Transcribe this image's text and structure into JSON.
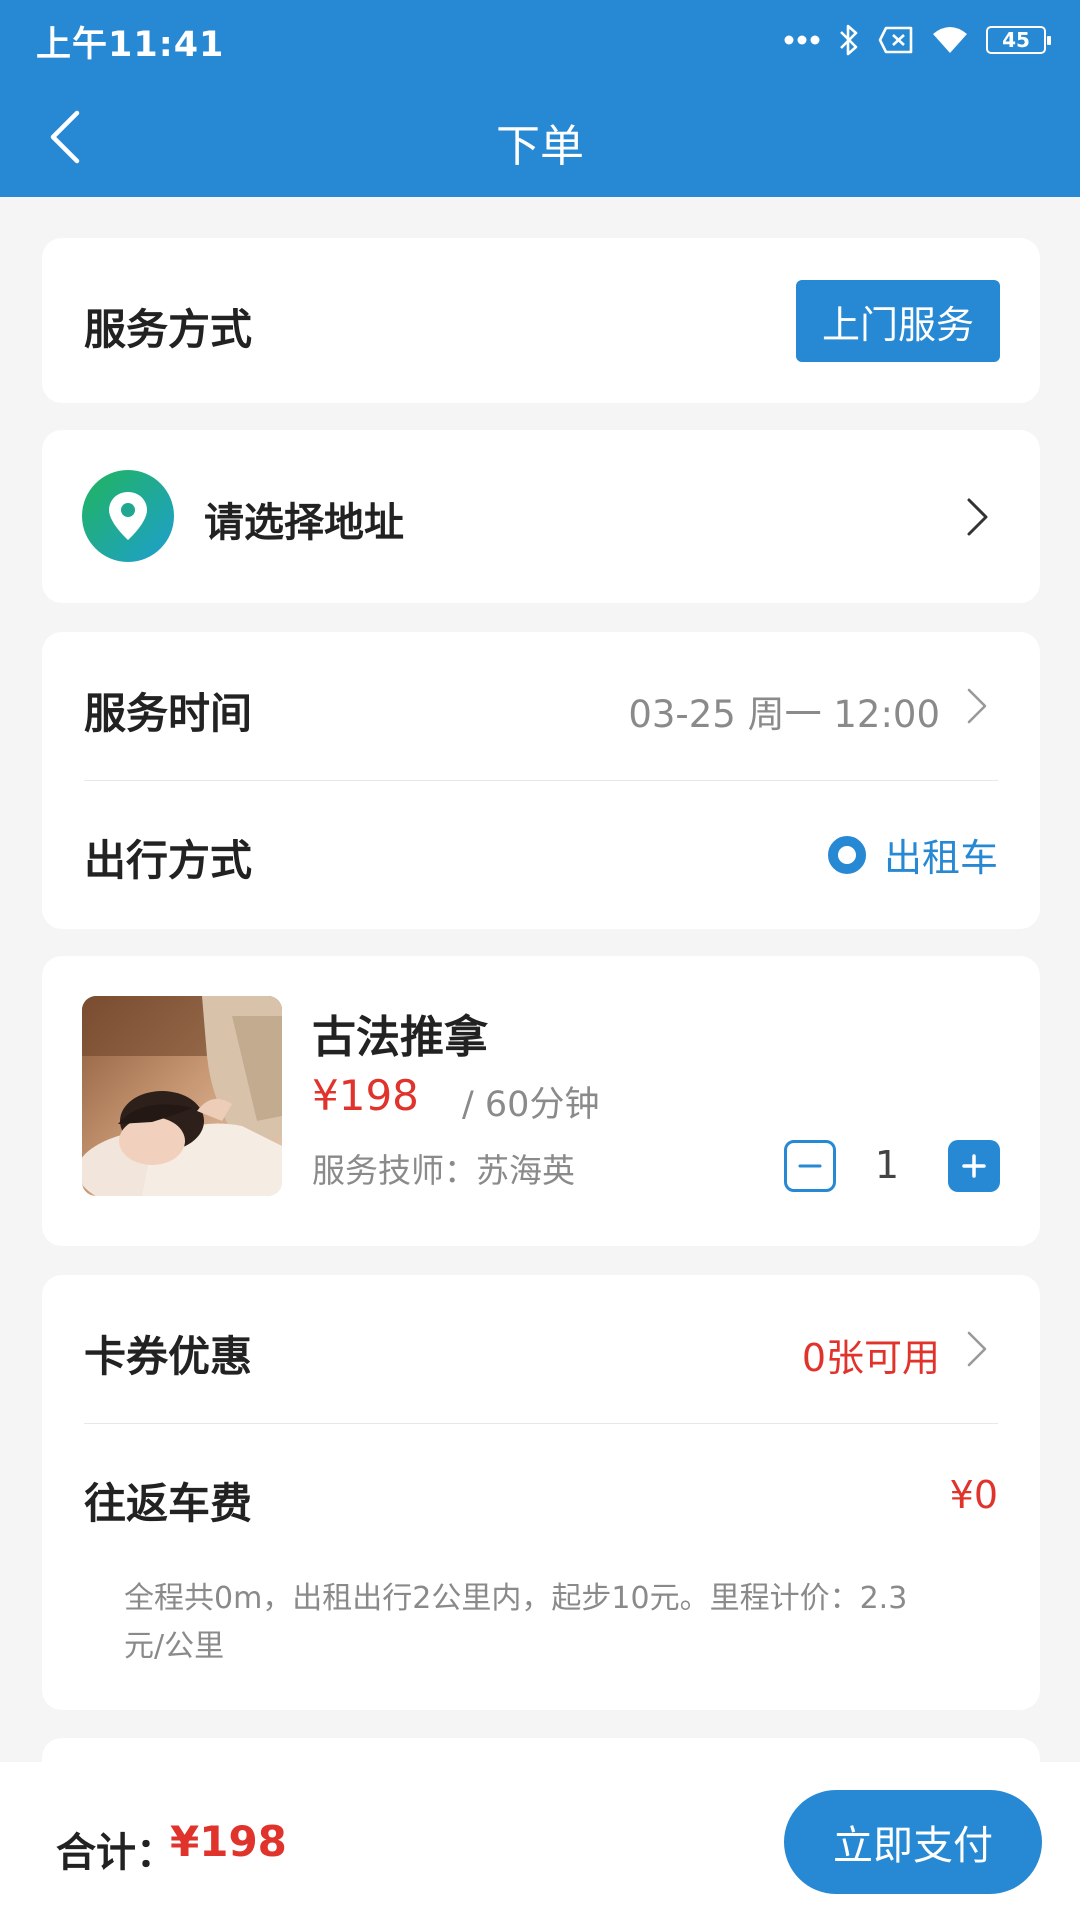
{
  "status_bar": {
    "time": "上午11:41",
    "battery": "45"
  },
  "nav": {
    "title": "下单"
  },
  "service_mode": {
    "label": "服务方式",
    "selected": "上门服务"
  },
  "address": {
    "placeholder": "请选择地址"
  },
  "schedule": {
    "time_label": "服务时间",
    "time_value": "03-25 周一 12:00",
    "travel_label": "出行方式",
    "travel_option": "出租车"
  },
  "product": {
    "name": "古法推拿",
    "price": "¥198",
    "unit": "/ 60分钟",
    "technician_label": "服务技师：",
    "technician_name": "苏海英",
    "quantity": "1"
  },
  "fees": {
    "coupon_label": "卡券优惠",
    "coupon_value": "0张可用",
    "fare_label": "往返车费",
    "fare_value": "¥0",
    "fare_note": "全程共0m，出租出行2公里内，起步10元。里程计价：2.3元/公里"
  },
  "checkout": {
    "total_label": "合计：",
    "total_value": "¥198",
    "pay_label": "立即支付"
  },
  "colors": {
    "primary": "#2788d4",
    "price": "#e0332b",
    "background": "#f5f5f5"
  },
  "icons": [
    "back-arrow-icon",
    "location-pin-icon",
    "chevron-right-icon",
    "minus-icon",
    "plus-icon",
    "bluetooth-icon",
    "wifi-icon",
    "battery-icon",
    "signal-dots-icon",
    "sim-icon"
  ]
}
